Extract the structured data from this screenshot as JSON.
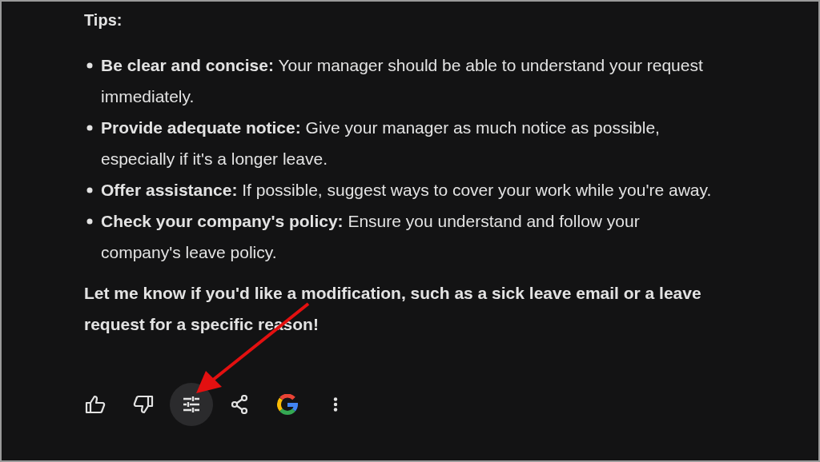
{
  "heading": "Tips:",
  "tips": [
    {
      "text": "**Be clear and concise:** Your manager should be able to understand your request immediately."
    },
    {
      "text": "**Provide adequate notice:** Give your manager as much notice as possible, especially if it's a longer leave."
    },
    {
      "text": "**Offer assistance:** If possible, suggest ways to cover your work while you're away."
    },
    {
      "text": "**Check your company's policy:** Ensure you understand and follow your company's leave policy."
    }
  ],
  "closing": "Let me know if you'd like a modification, such as a sick leave email or a leave request for a specific reason!",
  "actions": [
    {
      "kind": "thumbs-up",
      "selected": false
    },
    {
      "kind": "thumbs-down",
      "selected": false
    },
    {
      "kind": "tune",
      "selected": true
    },
    {
      "kind": "share",
      "selected": false
    },
    {
      "kind": "google",
      "selected": false
    },
    {
      "kind": "more",
      "selected": false
    }
  ]
}
